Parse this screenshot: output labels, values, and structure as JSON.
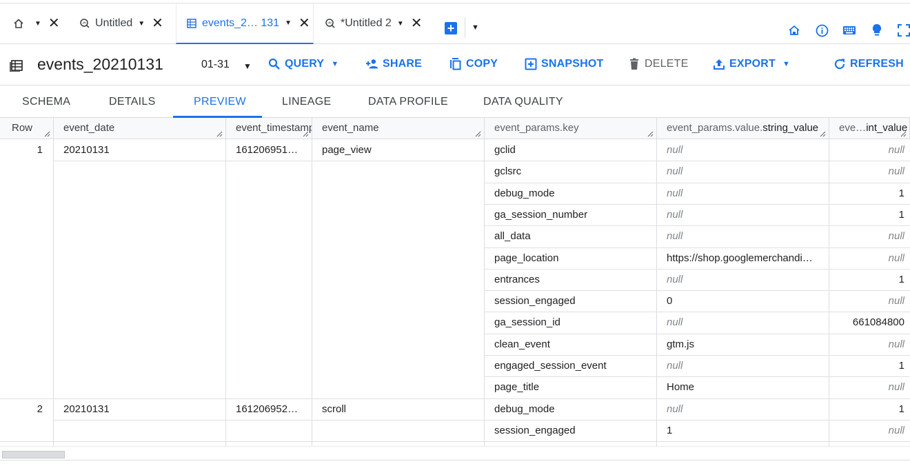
{
  "tabs": [
    {
      "label": "",
      "icon": "home-icon"
    },
    {
      "label": "Untitled",
      "icon": "query-icon"
    },
    {
      "label": "events_2… 131",
      "icon": "table-icon"
    },
    {
      "label": "*Untitled 2",
      "icon": "query-icon"
    }
  ],
  "toolbar": {
    "title": "events_20210131",
    "partition": "01-31",
    "query_label": "QUERY",
    "share_label": "SHARE",
    "copy_label": "COPY",
    "snapshot_label": "SNAPSHOT",
    "delete_label": "DELETE",
    "export_label": "EXPORT",
    "refresh_label": "REFRESH"
  },
  "subtabs": [
    "SCHEMA",
    "DETAILS",
    "PREVIEW",
    "LINEAGE",
    "DATA PROFILE",
    "DATA QUALITY"
  ],
  "active_subtab": "PREVIEW",
  "grid": {
    "headers": {
      "row": "Row",
      "event_date": "event_date",
      "event_timestamp": "event_timestamp",
      "event_name": "event_name",
      "key": "event_params.key",
      "string_value_prefix": "event_params.value.",
      "string_value_bold": "string_value",
      "int_value_prefix": "eve…",
      "int_value_bold": "int_value"
    },
    "records": [
      {
        "row": "1",
        "event_date": "20210131",
        "event_timestamp": "161206951…",
        "event_name": "page_view",
        "params": [
          {
            "key": "gclid",
            "string_value": "null",
            "int_value": "null"
          },
          {
            "key": "gclsrc",
            "string_value": "null",
            "int_value": "null"
          },
          {
            "key": "debug_mode",
            "string_value": "null",
            "int_value": "1"
          },
          {
            "key": "ga_session_number",
            "string_value": "null",
            "int_value": "1"
          },
          {
            "key": "all_data",
            "string_value": "null",
            "int_value": "null"
          },
          {
            "key": "page_location",
            "string_value": "https://shop.googlemerchandi…",
            "int_value": "null"
          },
          {
            "key": "entrances",
            "string_value": "null",
            "int_value": "1"
          },
          {
            "key": "session_engaged",
            "string_value": "0",
            "int_value": "null"
          },
          {
            "key": "ga_session_id",
            "string_value": "null",
            "int_value": "661084800"
          },
          {
            "key": "clean_event",
            "string_value": "gtm.js",
            "int_value": "null"
          },
          {
            "key": "engaged_session_event",
            "string_value": "null",
            "int_value": "1"
          },
          {
            "key": "page_title",
            "string_value": "Home",
            "int_value": "null"
          }
        ]
      },
      {
        "row": "2",
        "event_date": "20210131",
        "event_timestamp": "161206952…",
        "event_name": "scroll",
        "params": [
          {
            "key": "debug_mode",
            "string_value": "null",
            "int_value": "1"
          },
          {
            "key": "session_engaged",
            "string_value": "1",
            "int_value": "null"
          }
        ]
      }
    ]
  },
  "colors": {
    "accent": "#1a73e8",
    "border": "#dadce0",
    "muted": "#5f6368"
  }
}
